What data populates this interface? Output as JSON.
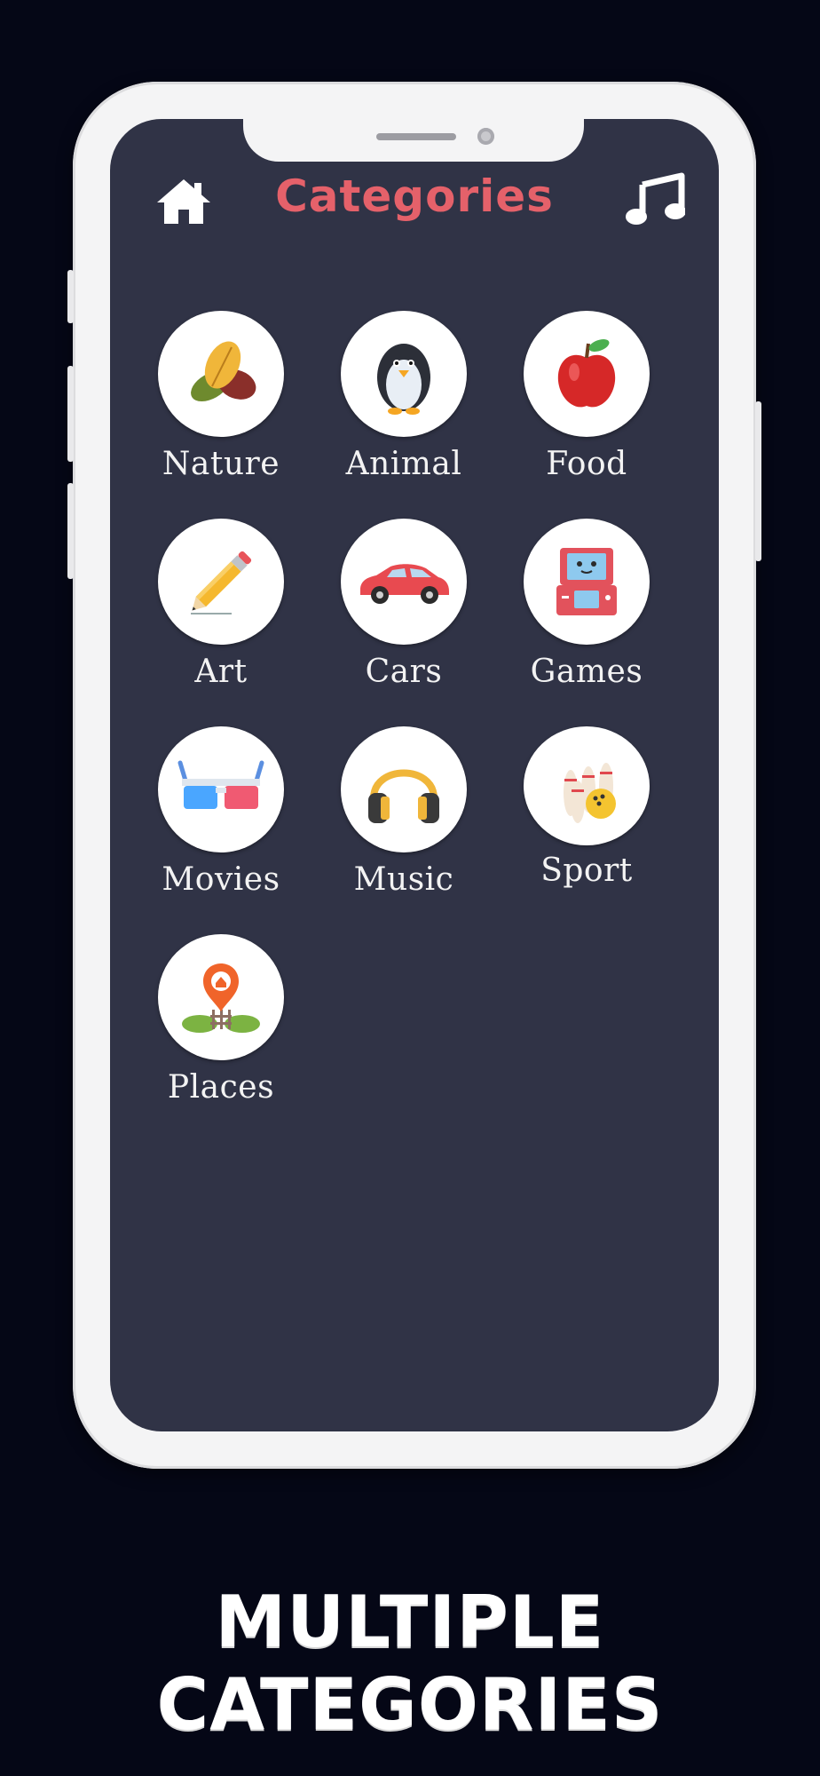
{
  "header": {
    "title": "Categories",
    "home_icon": "home-icon",
    "music_icon": "music-note-icon",
    "title_color": "#e5616a"
  },
  "categories": [
    {
      "label": "Nature",
      "icon": "leaves-icon"
    },
    {
      "label": "Animal",
      "icon": "penguin-icon"
    },
    {
      "label": "Food",
      "icon": "apple-icon"
    },
    {
      "label": "Art",
      "icon": "pencil-icon"
    },
    {
      "label": "Cars",
      "icon": "car-icon"
    },
    {
      "label": "Games",
      "icon": "handheld-console-icon"
    },
    {
      "label": "Movies",
      "icon": "3d-glasses-icon"
    },
    {
      "label": "Music",
      "icon": "headphones-icon"
    },
    {
      "label": "Sport",
      "icon": "bowling-icon"
    },
    {
      "label": "Places",
      "icon": "location-pin-icon"
    }
  ],
  "banner": {
    "text": "MULTIPLE CATEGORIES"
  },
  "colors": {
    "background": "#050716",
    "screen": "#303346",
    "phone_frame": "#f4f4f5"
  }
}
